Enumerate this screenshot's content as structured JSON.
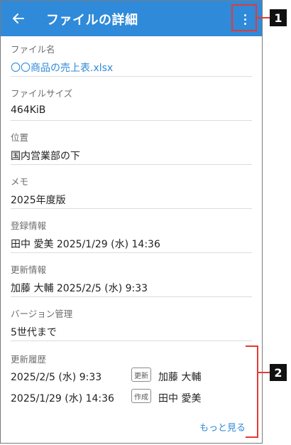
{
  "header": {
    "title": "ファイルの詳細",
    "back_icon": "arrow-left-icon",
    "menu_icon": "more-vertical-icon",
    "color": "#2f8ad9"
  },
  "fields": [
    {
      "label": "ファイル名",
      "value": "〇〇商品の売上表.xlsx",
      "is_link": true
    },
    {
      "label": "ファイルサイズ",
      "value": "464KiB"
    },
    {
      "label": "位置",
      "value": "国内営業部の下"
    },
    {
      "label": "メモ",
      "value": "2025年度版"
    },
    {
      "label": "登録情報",
      "value": "田中 愛美 2025/1/29 (水) 14:36"
    },
    {
      "label": "更新情報",
      "value": "加藤 大輔 2025/2/5 (水) 9:33"
    },
    {
      "label": "バージョン管理",
      "value": "5世代まで"
    }
  ],
  "history": {
    "label": "更新履歴",
    "rows": [
      {
        "date": "2025/2/5 (水) 9:33",
        "tag": "更新",
        "user": "加藤 大輔"
      },
      {
        "date": "2025/1/29 (水) 14:36",
        "tag": "作成",
        "user": "田中 愛美"
      }
    ],
    "more_label": "もっと見る"
  },
  "callouts": {
    "one": "1",
    "two": "2",
    "color": "#e53935"
  }
}
